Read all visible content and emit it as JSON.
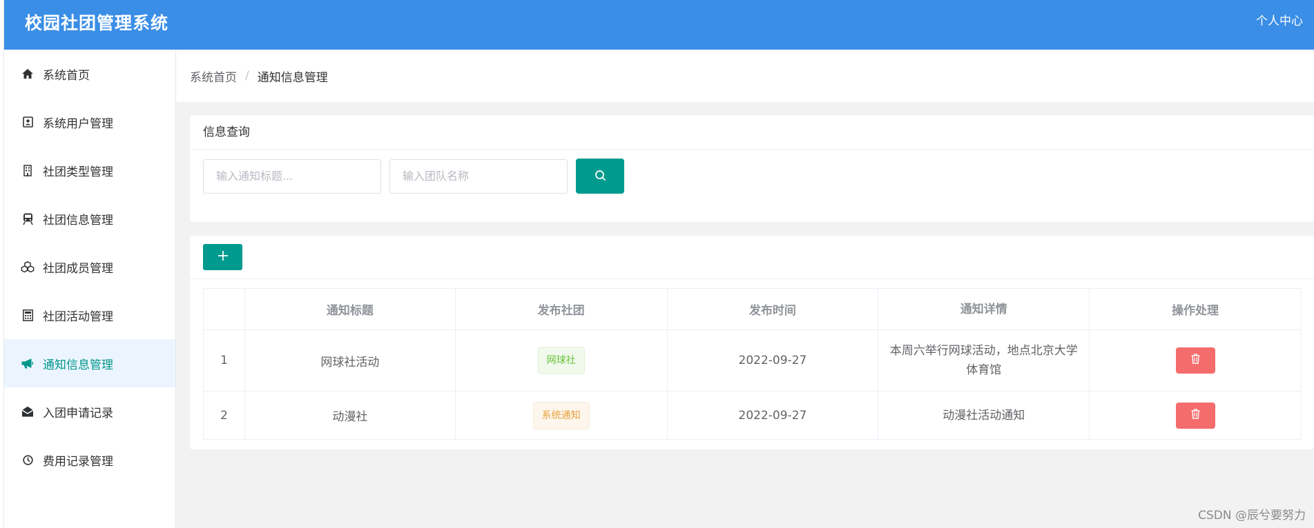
{
  "header": {
    "title": "校园社团管理系统",
    "user_center": "个人中心"
  },
  "sidebar": {
    "items": [
      {
        "label": "系统首页",
        "icon": "home-icon"
      },
      {
        "label": "系统用户管理",
        "icon": "id-card-icon"
      },
      {
        "label": "社团类型管理",
        "icon": "building-icon"
      },
      {
        "label": "社团信息管理",
        "icon": "train-icon"
      },
      {
        "label": "社团成员管理",
        "icon": "cubes-icon"
      },
      {
        "label": "社团活动管理",
        "icon": "calculator-icon"
      },
      {
        "label": "通知信息管理",
        "icon": "bullhorn-icon"
      },
      {
        "label": "入团申请记录",
        "icon": "envelope-open-icon"
      },
      {
        "label": "费用记录管理",
        "icon": "clock-icon"
      }
    ],
    "active_index": 6
  },
  "breadcrumb": {
    "home": "系统首页",
    "separator": "/",
    "current": "通知信息管理"
  },
  "query": {
    "title": "信息查询",
    "notice_title_placeholder": "输入通知标题...",
    "team_name_placeholder": "输入团队名称"
  },
  "table": {
    "headers": [
      "",
      "通知标题",
      "发布社团",
      "发布时间",
      "通知详情",
      "操作处理"
    ],
    "rows": [
      {
        "index": "1",
        "title": "网球社活动",
        "club": "网球社",
        "club_tag_type": "success",
        "time": "2022-09-27",
        "detail": "本周六举行网球活动，地点北京大学体育馆"
      },
      {
        "index": "2",
        "title": "动漫社",
        "club": "系统通知",
        "club_tag_type": "warning",
        "time": "2022-09-27",
        "detail": "动漫社活动通知"
      }
    ]
  },
  "watermark": "CSDN @辰兮要努力",
  "colors": {
    "header": "#3a8ee6",
    "primary": "#009b8e",
    "active_text": "#00968a",
    "danger": "#f56c6c"
  }
}
